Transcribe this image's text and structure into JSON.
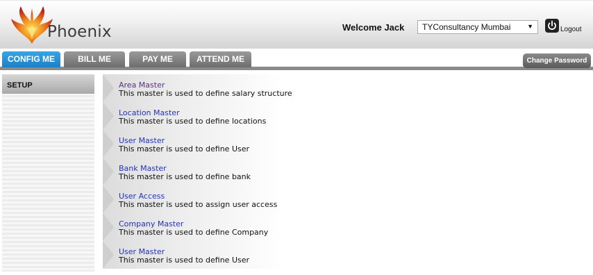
{
  "header": {
    "logo_text": "Phoenix",
    "welcome": "Welcome Jack",
    "company_selected": "TYConsultancy Mumbai",
    "logout_label": "Logout"
  },
  "nav": {
    "tabs": [
      {
        "label": "CONFIG ME",
        "active": true
      },
      {
        "label": "BILL ME",
        "active": false
      },
      {
        "label": "PAY ME",
        "active": false
      },
      {
        "label": "ATTEND ME",
        "active": false
      }
    ],
    "change_password": "Change Password"
  },
  "sidebar": {
    "section": "SETUP"
  },
  "items": [
    {
      "title": "Area Master",
      "desc": "This master is used to define salary structure"
    },
    {
      "title": "Location Master",
      "desc": "This master is used to define locations"
    },
    {
      "title": "User Master",
      "desc": "This master is used to define User"
    },
    {
      "title": "Bank Master",
      "desc": "This master is used to define bank"
    },
    {
      "title": "User Access",
      "desc": "This master is used to assign user access"
    },
    {
      "title": "Company Master",
      "desc": "This master is used to define Company"
    },
    {
      "title": "User Master",
      "desc": "This master is used to define User"
    }
  ],
  "colors": {
    "active_tab": "#1c80c7",
    "link": "#2433b8"
  }
}
